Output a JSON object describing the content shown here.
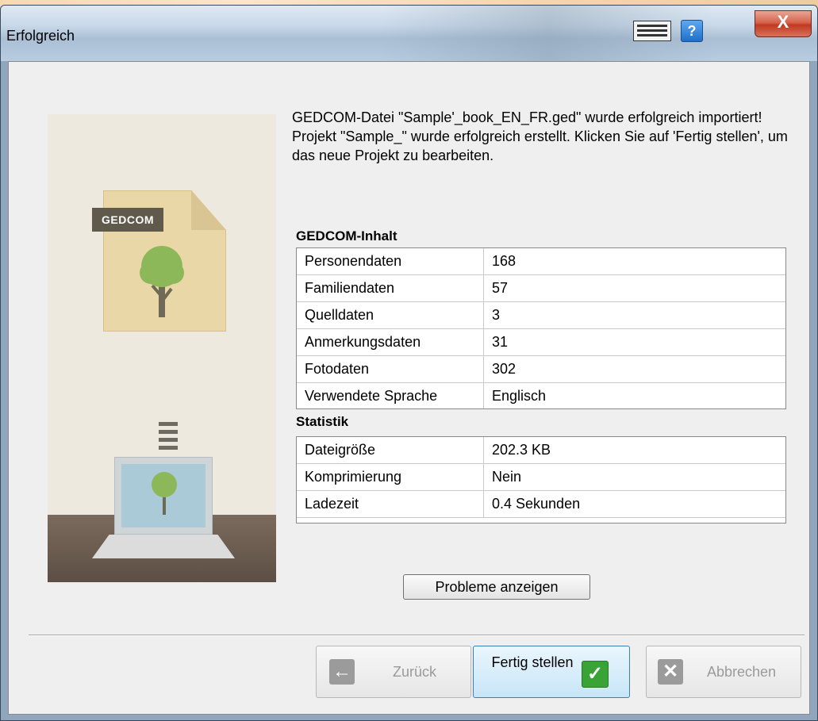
{
  "window": {
    "title": "Erfolgreich",
    "help_glyph": "?",
    "close_glyph": "X"
  },
  "illustration": {
    "tag": "GEDCOM"
  },
  "message": {
    "line1": "GEDCOM-Datei \"Sample'_book_EN_FR.ged\" wurde erfolgreich importiert!",
    "line2": "Projekt \"Sample_\" wurde erfolgreich erstellt. Klicken Sie auf 'Fertig stellen', um das neue Projekt zu bearbeiten."
  },
  "gedcom_content": {
    "title": "GEDCOM-Inhalt",
    "rows": [
      {
        "label": "Personendaten",
        "value": "168"
      },
      {
        "label": "Familiendaten",
        "value": "57"
      },
      {
        "label": "Quelldaten",
        "value": "3"
      },
      {
        "label": "Anmerkungsdaten",
        "value": "31"
      },
      {
        "label": "Fotodaten",
        "value": "302"
      },
      {
        "label": "Verwendete Sprache",
        "value": "Englisch"
      }
    ]
  },
  "statistics": {
    "title": "Statistik",
    "rows": [
      {
        "label": "Dateigröße",
        "value": "202.3 KB"
      },
      {
        "label": "Komprimierung",
        "value": "Nein"
      },
      {
        "label": "Ladezeit",
        "value": "0.4 Sekunden"
      }
    ]
  },
  "buttons": {
    "problems": "Probleme anzeigen",
    "back": "Zurück",
    "back_icon": "arrow-left-icon",
    "finish": "Fertig stellen",
    "finish_icon": "checkmark-icon",
    "cancel": "Abbrechen",
    "cancel_icon": "x-icon"
  }
}
